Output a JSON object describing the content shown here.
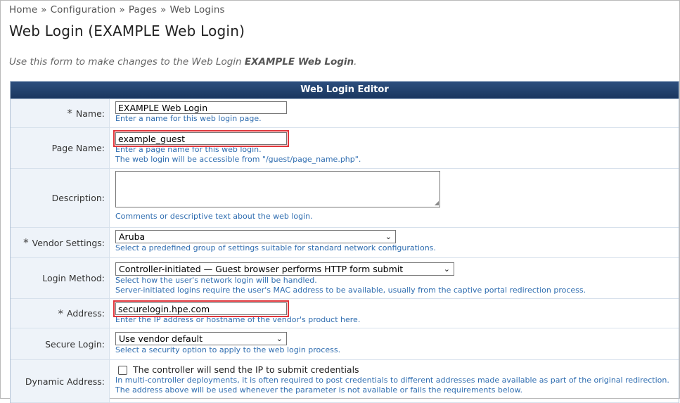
{
  "breadcrumb": {
    "items": [
      "Home",
      "Configuration",
      "Pages",
      "Web Logins"
    ],
    "separator": "»"
  },
  "page_title": "Web Login (EXAMPLE Web Login)",
  "intro": {
    "prefix": "Use this form to make changes to the Web Login ",
    "name": "EXAMPLE Web Login",
    "suffix": "."
  },
  "editor": {
    "header": "Web Login Editor",
    "name": {
      "label": "Name:",
      "required_mark": "*",
      "value": "EXAMPLE Web Login",
      "hint": "Enter a name for this web login page."
    },
    "page_name": {
      "label": "Page Name:",
      "value": "example_guest",
      "hint1": "Enter a page name for this web login.",
      "hint2": "The web login will be accessible from \"/guest/page_name.php\"."
    },
    "description": {
      "label": "Description:",
      "value": "",
      "hint": "Comments or descriptive text about the web login."
    },
    "vendor_settings": {
      "label": "Vendor Settings:",
      "required_mark": "*",
      "value": "Aruba",
      "hint": "Select a predefined group of settings suitable for standard network configurations."
    },
    "login_method": {
      "label": "Login Method:",
      "value": "Controller-initiated — Guest browser performs HTTP form submit",
      "hint1": "Select how the user's network login will be handled.",
      "hint2": "Server-initiated logins require the user's MAC address to be available, usually from the captive portal redirection process."
    },
    "address": {
      "label": "Address:",
      "required_mark": "*",
      "value": "securelogin.hpe.com",
      "hint": "Enter the IP address or hostname of the vendor's product here."
    },
    "secure_login": {
      "label": "Secure Login:",
      "value": "Use vendor default",
      "hint": "Select a security option to apply to the web login process."
    },
    "dynamic_address": {
      "label": "Dynamic Address:",
      "checkbox_label": "The controller will send the IP to submit credentials",
      "checked": false,
      "hint1": "In multi-controller deployments, it is often required to post credentials to different addresses made available as part of the original redirection.",
      "hint2": "The address above will be used whenever the parameter is not available or fails the requirements below."
    }
  },
  "icons": {
    "select_chevron": "chevron-down-icon",
    "resize_grip": "resize-grip-icon"
  },
  "colors": {
    "header_bg": "#1a365f",
    "label_bg": "#eef3f9",
    "hint_text": "#2f6db0",
    "highlight": "#e0353b"
  }
}
